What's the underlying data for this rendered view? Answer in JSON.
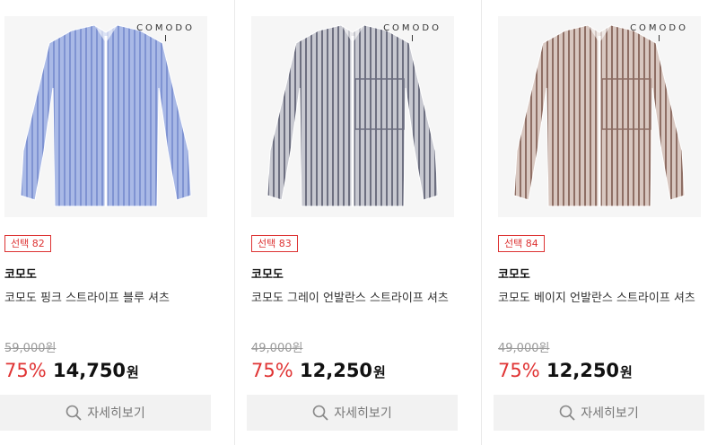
{
  "products": [
    {
      "photo_brand": "COMODO",
      "photo_brand_bar": "I",
      "shirt_color": "#a9b9e6",
      "stripe_color": "#7f93d2",
      "badge": "선택 82",
      "brand": "코모도",
      "name": "코모도 핑크 스트라이프 블루 셔츠",
      "original_price": "59,000원",
      "discount": "75%",
      "price": "14,750",
      "price_unit": "원",
      "detail_label": "자세히보기"
    },
    {
      "photo_brand": "COMODO",
      "photo_brand_bar": "I",
      "shirt_color": "#c7c8d0",
      "stripe_color": "#6d6f80",
      "badge": "선택 83",
      "brand": "코모도",
      "name": "코모도 그레이 언발란스 스트라이프 셔츠",
      "original_price": "49,000원",
      "discount": "75%",
      "price": "12,250",
      "price_unit": "원",
      "detail_label": "자세히보기"
    },
    {
      "photo_brand": "COMODO",
      "photo_brand_bar": "I",
      "shirt_color": "#d8c7c0",
      "stripe_color": "#8e6e64",
      "badge": "선택 84",
      "brand": "코모도",
      "name": "코모도 베이지 언발란스 스트라이프 셔츠",
      "original_price": "49,000원",
      "discount": "75%",
      "price": "12,250",
      "price_unit": "원",
      "detail_label": "자세히보기"
    }
  ]
}
